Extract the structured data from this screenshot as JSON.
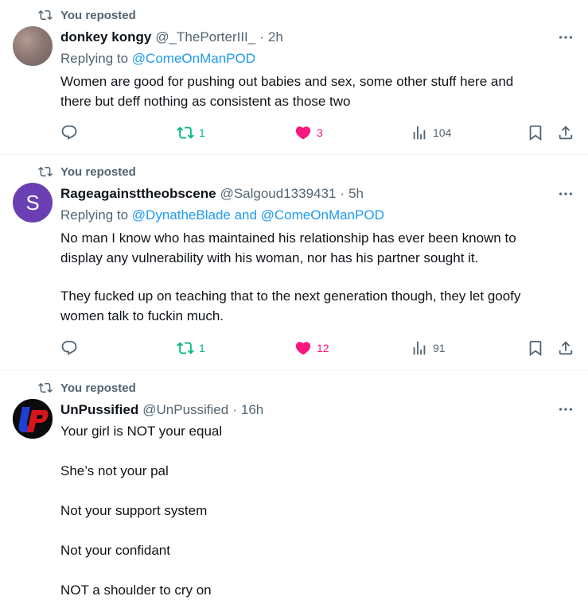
{
  "repost_label": "You reposted",
  "replying_prefix": "Replying to",
  "tweets": [
    {
      "name": "donkey kongy",
      "handle": "@_ThePorterIII_",
      "time": "2h",
      "replying_to": "@ComeOnManPOD",
      "lines": [
        "Women are good for pushing out babies and sex, some other stuff here and",
        "there but deff nothing as consistent as those two"
      ],
      "retweets": "1",
      "likes": "3",
      "views": "104"
    },
    {
      "name": "Rageagainsttheobscene",
      "handle": "@Salgoud1339431",
      "avatar_letter": "S",
      "time": "5h",
      "replying_to": "@DynatheBlade and @ComeOnManPOD",
      "lines": [
        "No man I know who has maintained his relationship has ever been known to",
        "display any vulnerability with his woman, nor has his partner sought it.",
        "",
        "They fucked up on teaching that to the next generation though, they let goofy",
        "women talk to fuckin much."
      ],
      "retweets": "1",
      "likes": "12",
      "views": "91"
    },
    {
      "name": "UnPussified",
      "handle": "@UnPussified",
      "time": "16h",
      "lines": [
        "Your girl is NOT your equal",
        "She’s not your pal",
        "Not your support system",
        "Not your confidant",
        "NOT a shoulder to cry on"
      ]
    }
  ],
  "icons": {
    "repost": "repost-icon",
    "more": "more-icon",
    "reply": "reply-icon",
    "like": "heart-icon",
    "views": "views-icon",
    "bookmark": "bookmark-icon",
    "share": "share-icon"
  },
  "colors": {
    "text": "#0f1419",
    "muted": "#536471",
    "link": "#1d9bf0",
    "repost_active": "#00ba7c",
    "like_active": "#f91880",
    "avatar_s": "#6a3fb3"
  }
}
